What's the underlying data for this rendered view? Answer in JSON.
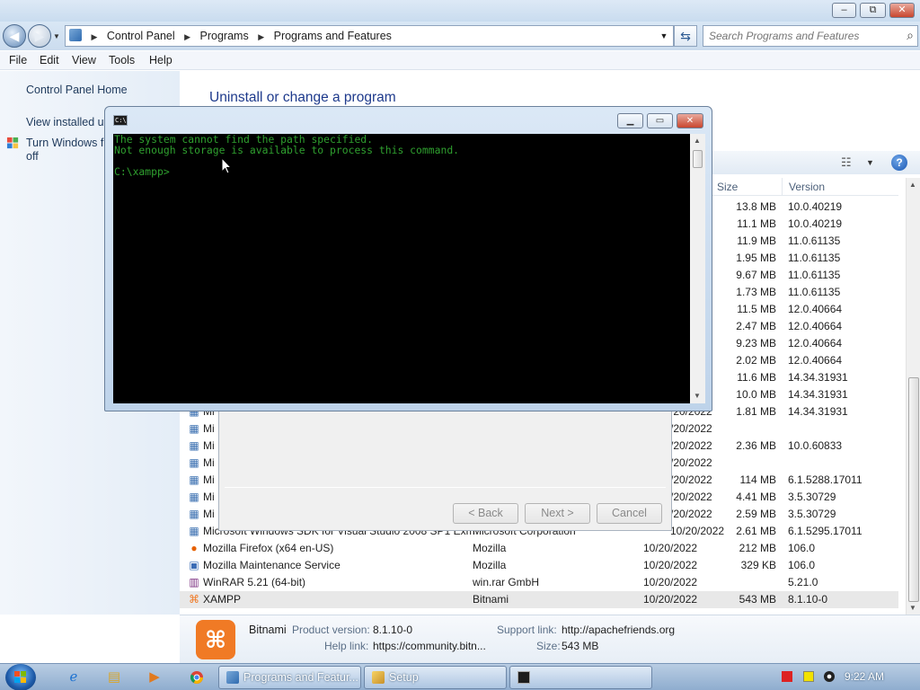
{
  "window": {
    "caption_buttons": {
      "minimize": "–",
      "maximize": "⧉",
      "close": "✕"
    }
  },
  "address": {
    "back_icon": "◀",
    "forward_icon": "▶",
    "crumbs": [
      "Control Panel",
      "Programs",
      "Programs and Features"
    ],
    "search_placeholder": "Search Programs and Features"
  },
  "menu": [
    "File",
    "Edit",
    "View",
    "Tools",
    "Help"
  ],
  "left_pane": {
    "home": "Control Panel Home",
    "installed_updates": "View installed up",
    "features_line1": "Turn Windows fe",
    "features_line2": "off"
  },
  "content": {
    "heading": "Uninstall or change a program",
    "columns": {
      "size": "Size",
      "version": "Version"
    },
    "top_rows": [
      {
        "size": "13.8 MB",
        "version": "10.0.40219"
      },
      {
        "size": "11.1 MB",
        "version": "10.0.40219"
      },
      {
        "size": "11.9 MB",
        "version": "11.0.61135"
      },
      {
        "size": "1.95 MB",
        "version": "11.0.61135"
      },
      {
        "size": "9.67 MB",
        "version": "11.0.61135"
      },
      {
        "size": "1.73 MB",
        "version": "11.0.61135"
      },
      {
        "size": "11.5 MB",
        "version": "12.0.40664"
      },
      {
        "size": "2.47 MB",
        "version": "12.0.40664"
      },
      {
        "size": "9.23 MB",
        "version": "12.0.40664"
      },
      {
        "size": "2.02 MB",
        "version": "12.0.40664"
      },
      {
        "size": "11.6 MB",
        "version": "14.34.31931"
      },
      {
        "size": "10.0 MB",
        "version": "14.34.31931"
      }
    ],
    "mid_rows": [
      {
        "name": "Mi",
        "date": "/20/2022",
        "size": "1.81 MB",
        "version": "14.34.31931"
      },
      {
        "name": "Mi",
        "date": "/20/2022",
        "size": "",
        "version": ""
      },
      {
        "name": "Mi",
        "date": "/20/2022",
        "size": "2.36 MB",
        "version": "10.0.60833"
      },
      {
        "name": "Mi",
        "date": "/20/2022",
        "size": "",
        "version": ""
      },
      {
        "name": "Mi",
        "date": "/20/2022",
        "size": "114 MB",
        "version": "6.1.5288.17011"
      },
      {
        "name": "Mi",
        "date": "/20/2022",
        "size": "4.41 MB",
        "version": "3.5.30729"
      },
      {
        "name": "Mi",
        "date": "/20/2022",
        "size": "2.59 MB",
        "version": "3.5.30729"
      },
      {
        "name": "Microsoft Windows SDK for Visual Studio 2008 SP1 Exm",
        "publisher": "Microsoft Corporation",
        "date": "10/20/2022",
        "size": "2.61 MB",
        "version": "6.1.5295.17011"
      }
    ],
    "bottom_rows": [
      {
        "name": "Mozilla Firefox (x64 en-US)",
        "publisher": "Mozilla",
        "date": "10/20/2022",
        "size": "212 MB",
        "version": "106.0",
        "icon": "firefox-icon"
      },
      {
        "name": "Mozilla Maintenance Service",
        "publisher": "Mozilla",
        "date": "10/20/2022",
        "size": "329 KB",
        "version": "106.0",
        "icon": "maintenance-icon"
      },
      {
        "name": "WinRAR 5.21 (64-bit)",
        "publisher": "win.rar GmbH",
        "date": "10/20/2022",
        "size": "",
        "version": "5.21.0",
        "icon": "winrar-icon"
      },
      {
        "name": "XAMPP",
        "publisher": "Bitnami",
        "date": "10/20/2022",
        "size": "543 MB",
        "version": "8.1.10-0",
        "icon": "xampp-icon"
      }
    ]
  },
  "details": {
    "publisher": "Bitnami",
    "product_version_label": "Product version:",
    "product_version": "8.1.10-0",
    "support_link_label": "Support link:",
    "support_link": "http://apachefriends.org",
    "help_link_label": "Help link:",
    "help_link": "https://community.bitn...",
    "size_label": "Size:",
    "size": "543 MB"
  },
  "setup_dialog": {
    "back": "< Back",
    "next": "Next >",
    "cancel": "Cancel"
  },
  "console": {
    "icon_text": "C:\\",
    "line1": "The system cannot find the path specified.",
    "line2": "Not enough storage is available to process this command.",
    "prompt": "C:\\xampp>"
  },
  "taskbar": {
    "tasks": [
      "Programs and Featur...",
      "Setup",
      ""
    ],
    "clock": "9:22 AM"
  }
}
